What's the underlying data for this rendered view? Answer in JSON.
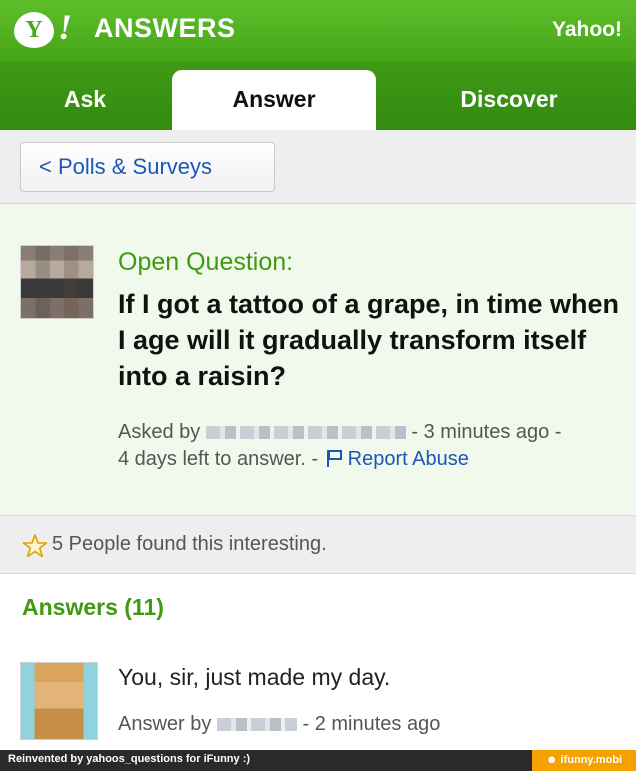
{
  "header": {
    "logo_badge": "Y",
    "logo_excl": "!",
    "logo_text": "ANSWERS",
    "yahoo_link": "Yahoo!"
  },
  "tabs": [
    {
      "label": "Ask"
    },
    {
      "label": "Answer",
      "active": true
    },
    {
      "label": "Discover"
    }
  ],
  "breadcrumb": {
    "label": "< Polls & Surveys"
  },
  "question": {
    "label": "Open Question:",
    "title": "If I got a tattoo of a grape, in time when I age will it gradually transform itself into a raisin?",
    "asked_by": "Asked by",
    "time_ago": "- 3 minutes ago -",
    "time_left": "4 days left to answer. -",
    "report_link": "Report Abuse"
  },
  "interest": {
    "text": "5 People found this interesting."
  },
  "answers": {
    "heading": "Answers (11)",
    "items": [
      {
        "text": "You, sir, just made my day.",
        "answer_by": "Answer by",
        "time_ago": "- 2 minutes ago"
      }
    ]
  },
  "footer": {
    "left_text": "Reinvented by yahoos_questions for iFunny :)",
    "right_text": "☻ ifunny.mobi"
  },
  "colors": {
    "header_green": "#4aa81d",
    "tab_green": "#338a0f",
    "question_green": "#3e9a13",
    "link_blue": "#1a57b8",
    "footer_orange": "#f5a100"
  }
}
